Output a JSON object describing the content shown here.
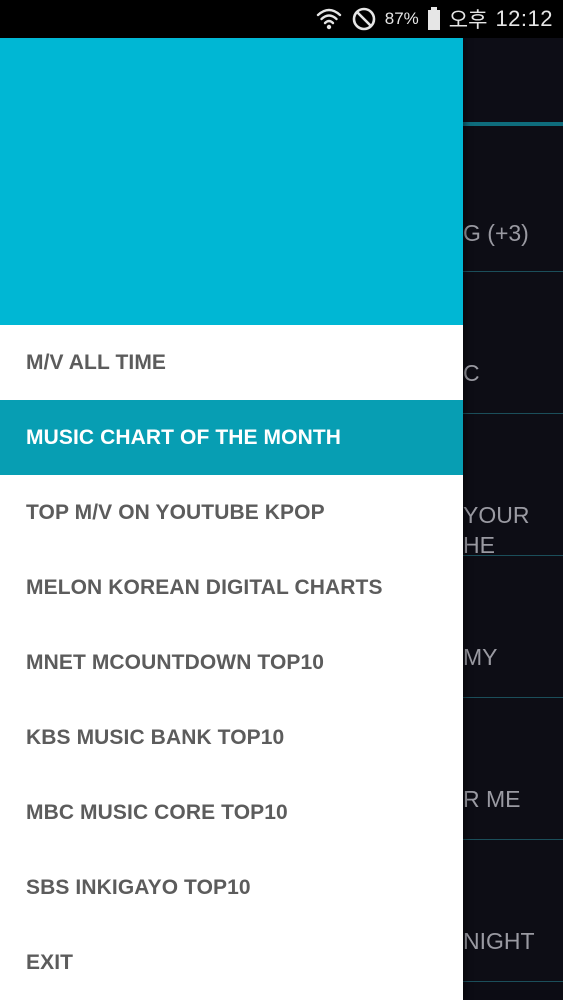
{
  "status_bar": {
    "battery_percent": "87%",
    "ampm": "오후",
    "time": "12:12",
    "icons": [
      "wifi-icon",
      "no-disturb-icon",
      "battery-icon"
    ]
  },
  "background_list": {
    "rows": [
      "G (+3)",
      "C",
      "YOUR\nHE",
      "MY",
      "R ME",
      "NIGHT"
    ]
  },
  "drawer": {
    "header_color": "#00b7d4",
    "active_color": "#079eb3",
    "items": [
      {
        "label": "M/V ALL TIME"
      },
      {
        "label": "MUSIC CHART OF THE MONTH",
        "selected": true
      },
      {
        "label": "TOP M/V ON YOUTUBE KPOP"
      },
      {
        "label": "MELON KOREAN DIGITAL CHARTS"
      },
      {
        "label": "MNET MCOUNTDOWN TOP10"
      },
      {
        "label": "KBS MUSIC BANK TOP10"
      },
      {
        "label": "MBC MUSIC CORE TOP10"
      },
      {
        "label": "SBS INKIGAYO TOP10"
      },
      {
        "label": "EXIT"
      }
    ]
  }
}
